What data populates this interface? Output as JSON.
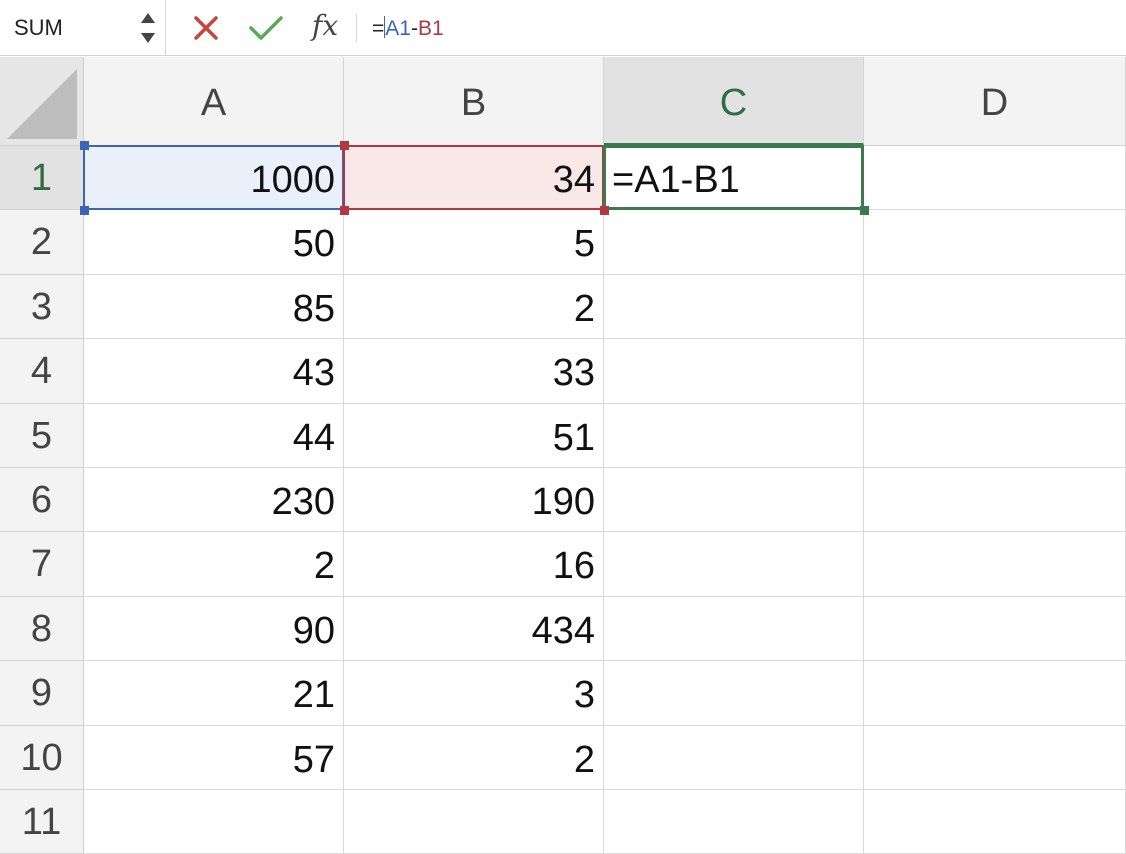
{
  "formula_bar": {
    "name_box": "SUM",
    "cancel_icon": "x-icon",
    "confirm_icon": "check-icon",
    "fx_label": "fx",
    "formula_prefix": "=",
    "formula_ref_a": "A1",
    "formula_minus": "-",
    "formula_ref_b": "B1"
  },
  "grid": {
    "columns": [
      "A",
      "B",
      "C",
      "D"
    ],
    "active_column": "C",
    "rows": [
      "1",
      "2",
      "3",
      "4",
      "5",
      "6",
      "7",
      "8",
      "9",
      "10",
      "11"
    ],
    "active_row": "1",
    "cells": [
      [
        "1000",
        "34",
        "=A1-B1",
        ""
      ],
      [
        "50",
        "5",
        "",
        ""
      ],
      [
        "85",
        "2",
        "",
        ""
      ],
      [
        "43",
        "33",
        "",
        ""
      ],
      [
        "44",
        "51",
        "",
        ""
      ],
      [
        "230",
        "190",
        "",
        ""
      ],
      [
        "2",
        "16",
        "",
        ""
      ],
      [
        "90",
        "434",
        "",
        ""
      ],
      [
        "21",
        "3",
        "",
        ""
      ],
      [
        "57",
        "2",
        "",
        ""
      ],
      [
        "",
        "",
        "",
        ""
      ]
    ]
  },
  "colors": {
    "ref_a": "#3a66b5",
    "ref_b": "#b0383e",
    "active_cell": "#3a7a4c",
    "cancel": "#c8453f",
    "confirm": "#5aa85a"
  }
}
